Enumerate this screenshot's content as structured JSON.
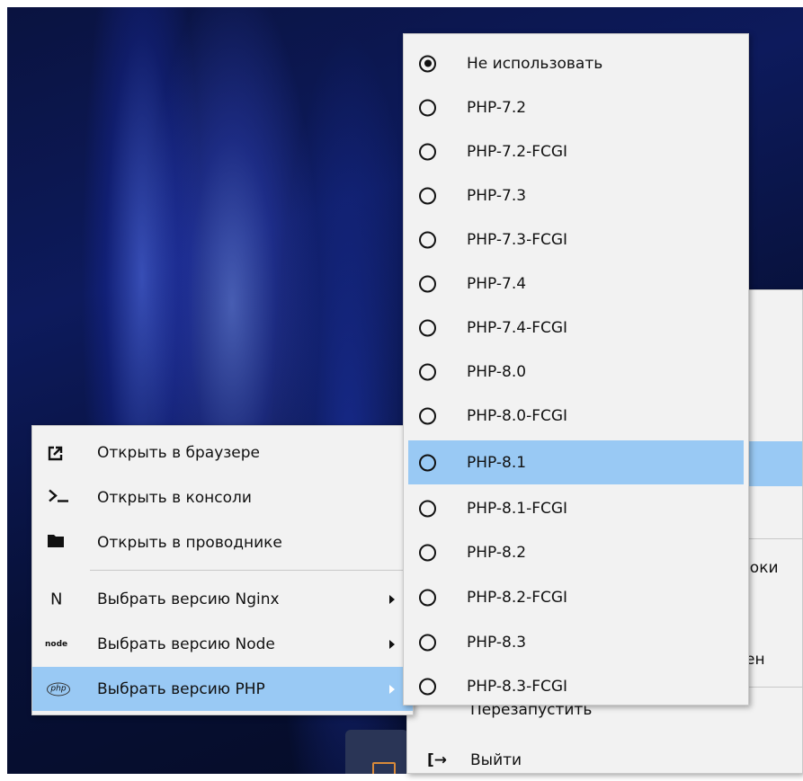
{
  "background_menu": {
    "item_partial_1": "роки",
    "item_partial_2": "ен",
    "restart_label": "Перезапустить",
    "exit_label": "Выйти"
  },
  "context_menu": {
    "items": [
      {
        "icon": "external-link-icon",
        "label": "Открыть в браузере"
      },
      {
        "icon": "terminal-icon",
        "label": "Открыть в консоли"
      },
      {
        "icon": "folder-icon",
        "label": "Открыть в проводнике"
      },
      {
        "icon": "nginx-icon",
        "icon_text": "N",
        "label": "Выбрать версию Nginx"
      },
      {
        "icon": "node-icon",
        "icon_text": "node",
        "label": "Выбрать версию Node"
      },
      {
        "icon": "php-icon",
        "icon_text": "php",
        "label": "Выбрать версию PHP"
      }
    ]
  },
  "php_submenu": {
    "selected": "Не использовать",
    "highlighted": "PHP-8.1",
    "items": [
      "Не использовать",
      "PHP-7.2",
      "PHP-7.2-FCGI",
      "PHP-7.3",
      "PHP-7.3-FCGI",
      "PHP-7.4",
      "PHP-7.4-FCGI",
      "PHP-8.0",
      "PHP-8.0-FCGI",
      "PHP-8.1",
      "PHP-8.1-FCGI",
      "PHP-8.2",
      "PHP-8.2-FCGI",
      "PHP-8.3",
      "PHP-8.3-FCGI"
    ]
  },
  "colors": {
    "highlight": "#99c9f4",
    "menu_background": "#f2f2f2"
  }
}
